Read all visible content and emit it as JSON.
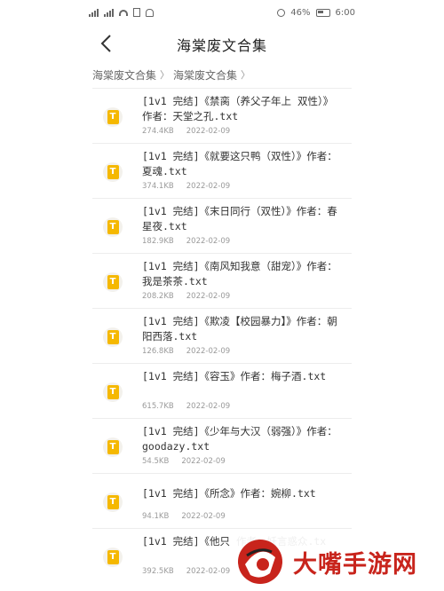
{
  "status_bar": {
    "left_icons": [
      "signal-icon",
      "signal-icon",
      "wifi-icon",
      "sim-icon",
      "headset-icon"
    ],
    "battery_percent": "46%",
    "time": "6:00"
  },
  "header": {
    "back_icon": "chevron-left-icon",
    "title": "海棠废文合集"
  },
  "breadcrumb": {
    "items": [
      "海棠废文合集",
      "海棠废文合集"
    ],
    "separator": "〉"
  },
  "files": [
    {
      "name": "[1v1 完结]《禁脔（养父子年上 双性）》作者：天堂之孔.txt",
      "size": "274.4KB",
      "date": "2022-02-09"
    },
    {
      "name": "[1v1 完结]《就要这只鸭（双性）》作者：夏魂.txt",
      "size": "374.1KB",
      "date": "2022-02-09"
    },
    {
      "name": "[1v1 完结]《末日同行（双性）》作者：春星夜.txt",
      "size": "182.9KB",
      "date": "2022-02-09"
    },
    {
      "name": "[1v1 完结]《南风知我意（甜宠）》作者：我是茶茶.txt",
      "size": "208.2KB",
      "date": "2022-02-09"
    },
    {
      "name": "[1v1 完结]《欺凌【校园暴力】》作者：朝阳西落.txt",
      "size": "126.8KB",
      "date": "2022-02-09"
    },
    {
      "name": "[1v1 完结]《容玉》作者：梅子酒.txt",
      "size": "615.7KB",
      "date": "2022-02-09"
    },
    {
      "name": "[1v1 完结]《少年与大汉（弱强）》作者：goodazy.txt",
      "size": "54.5KB",
      "date": "2022-02-09"
    },
    {
      "name": "[1v1 完结]《所念》作者：婉柳.txt",
      "size": "94.1KB",
      "date": "2022-02-09"
    },
    {
      "name": "[1v1 完结]《他只 作者：妖言惑众.tx",
      "size": "392.5KB",
      "date": "2022-02-09"
    }
  ],
  "file_icon_letter": "T",
  "file_icon_color": "#f5b800",
  "watermark": {
    "text": "大嘴手游网",
    "color": "#c8241c"
  }
}
